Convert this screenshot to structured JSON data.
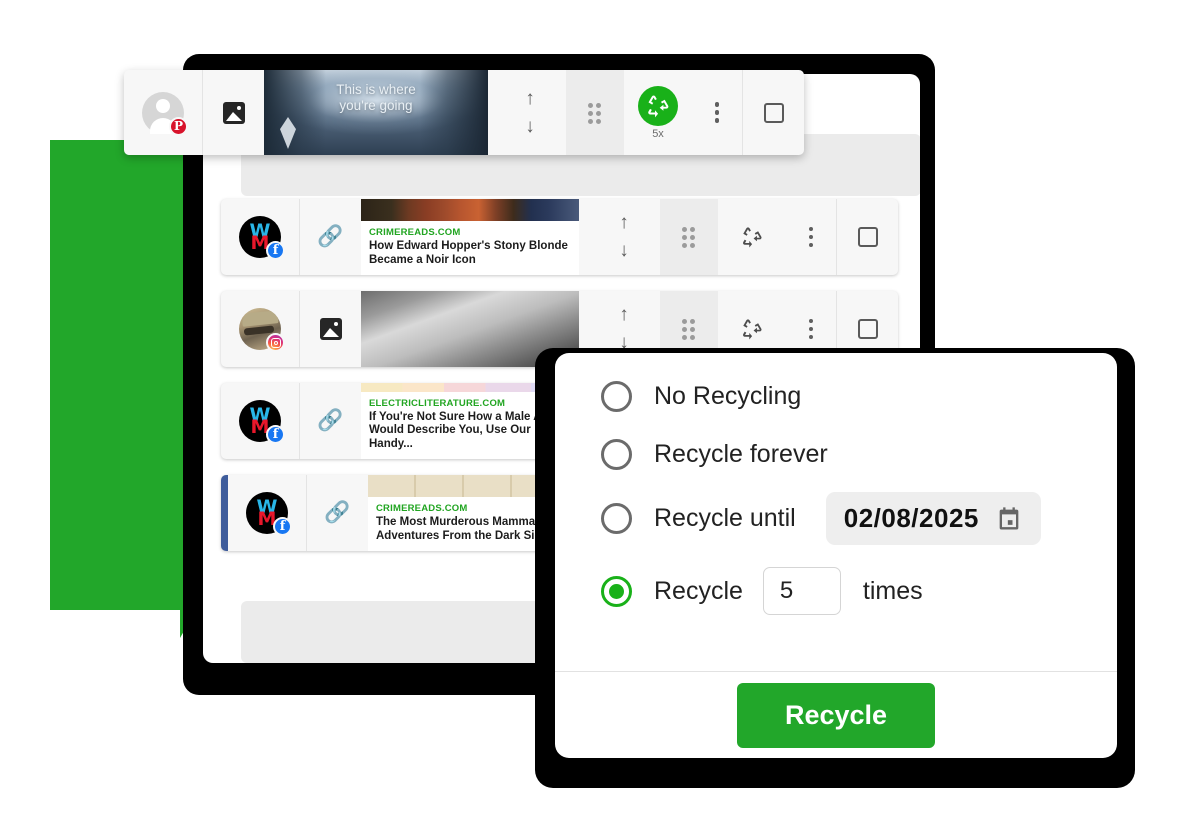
{
  "toolbar_card": {
    "avatar": {
      "type": "person-placeholder",
      "badge": "pinterest"
    },
    "post_type_icon": "image-icon",
    "hero": {
      "text_line1": "This is where",
      "text_line2": "you're going",
      "logo": "diamond-logo"
    },
    "controls": {
      "move_up": "↑",
      "move_down": "↓",
      "drag_handle": "drag-handle-icon",
      "recycle_icon": "recycle-icon",
      "recycle_count": "5x",
      "kebab": "more-options-icon",
      "checkbox": "select-checkbox"
    }
  },
  "rows": [
    {
      "avatar": "wm-logo",
      "badge": "facebook",
      "post_type_icon": "link-icon",
      "domain": "CRIMEREADS.COM",
      "title": "How Edward Hopper's Stony Blonde Became a Noir Icon",
      "thumb": "hopper",
      "selected": false
    },
    {
      "avatar": "photo-person",
      "badge": "instagram",
      "post_type_icon": "image-icon",
      "domain": "",
      "title": "",
      "thumb": "detective",
      "selected": false
    },
    {
      "avatar": "wm-logo",
      "badge": "facebook",
      "post_type_icon": "link-icon",
      "domain": "ELECTRICLITERATURE.COM",
      "title": "If You're Not Sure How a Male Author Would Describe You, Use Our Handy...",
      "thumb": "chart",
      "selected": false
    },
    {
      "avatar": "wm-logo",
      "badge": "facebook",
      "post_type_icon": "link-icon",
      "domain": "CRIMEREADS.COM",
      "title": "The Most Murderous Mammals: Adventures From the Dark Side of...",
      "thumb": "mammals",
      "selected": true
    }
  ],
  "row_controls": {
    "move_up": "↑",
    "move_down": "↓",
    "drag_handle": "drag-handle-icon",
    "recycle_icon": "recycle-icon",
    "kebab": "more-options-icon",
    "checkbox": "select-checkbox"
  },
  "dialog": {
    "options": [
      {
        "id": "no-recycling",
        "label": "No Recycling",
        "selected": false
      },
      {
        "id": "recycle-forever",
        "label": "Recycle forever",
        "selected": false
      },
      {
        "id": "recycle-until",
        "label": "Recycle until",
        "selected": false
      },
      {
        "id": "recycle-times",
        "label": "Recycle",
        "selected": true
      }
    ],
    "date_value": "02/08/2025",
    "calendar_icon": "calendar-icon",
    "times_value": "5",
    "times_suffix": "times",
    "submit_label": "Recycle"
  },
  "colors": {
    "accent_green": "#22a72a",
    "button_green": "#22a72a",
    "recycle_green": "#19b119",
    "selected_blue": "#3f5d9c",
    "domain_green": "#21a521",
    "frame_black": "#000000"
  }
}
